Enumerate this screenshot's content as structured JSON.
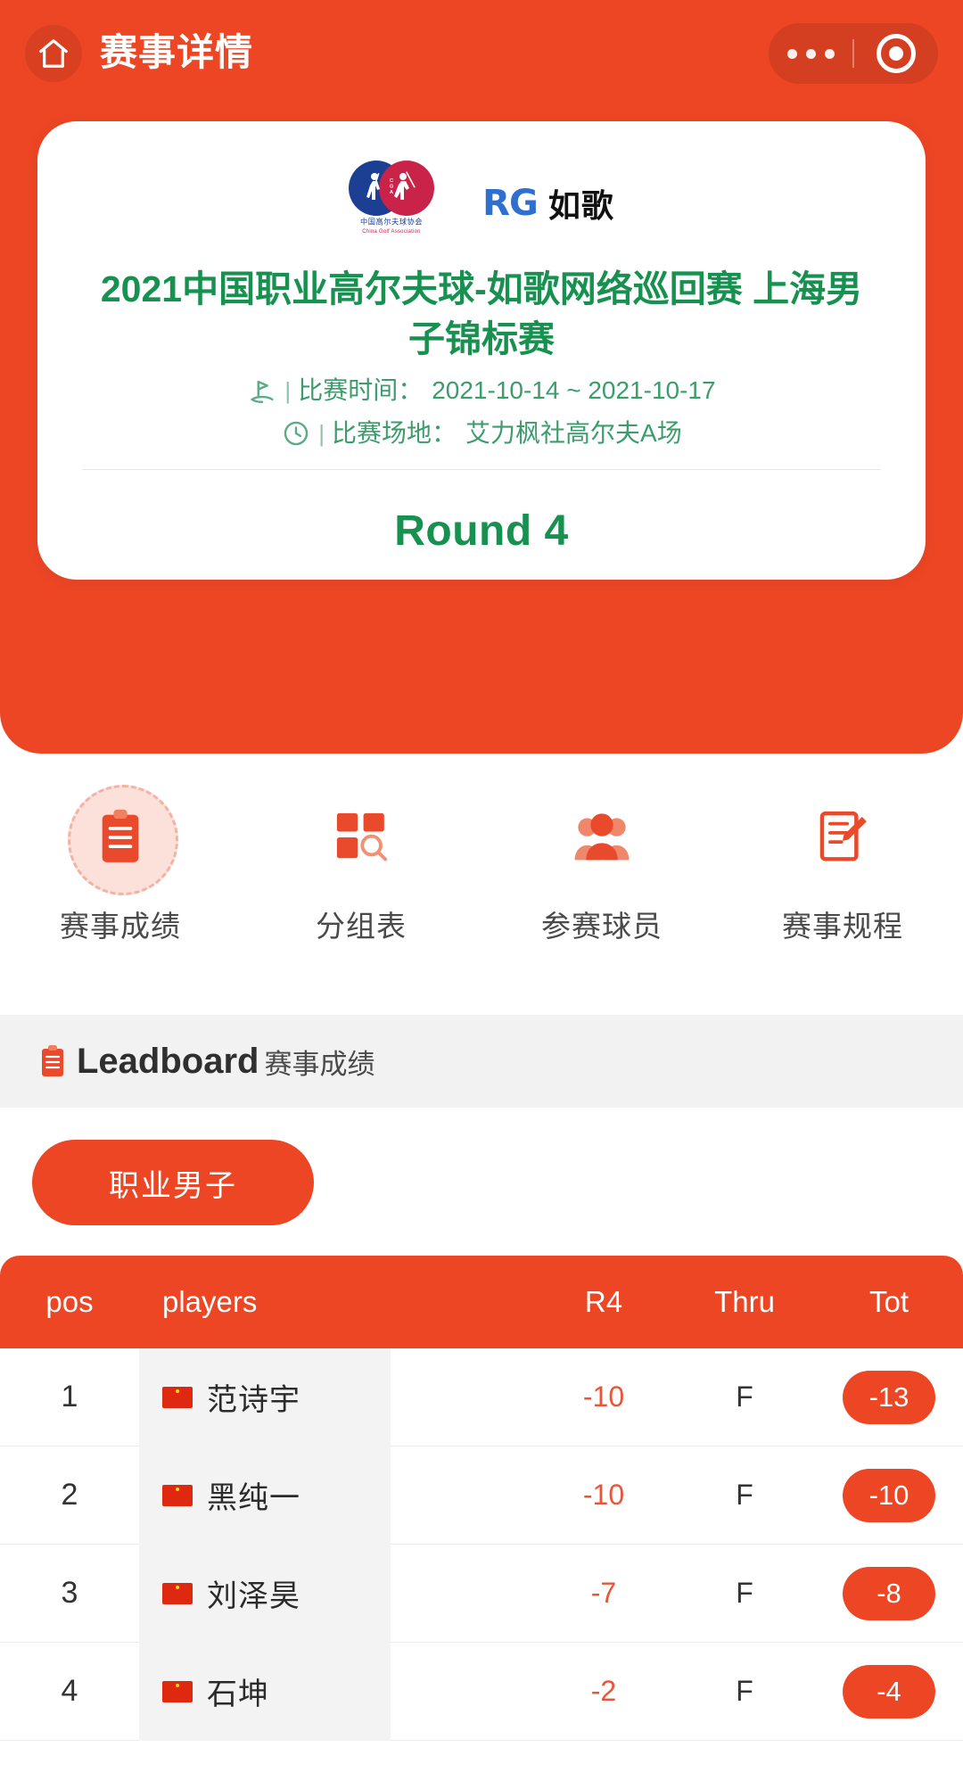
{
  "navbar": {
    "home_icon": "home-icon",
    "title": "赛事详情",
    "capsule": {
      "more_icon": "ellipsis-icon",
      "target_icon": "target-circle-icon"
    }
  },
  "card": {
    "logos": {
      "cga": {
        "cn": "中国高尔夫球协会",
        "en": "China Golf Association"
      },
      "rg": {
        "mark": "RG",
        "cn": "如歌"
      }
    },
    "title": "2021中国职业高尔夫球-如歌网络巡回赛 上海男子锦标赛",
    "meta": [
      {
        "icon": "golf-flag-icon",
        "label": "比赛时间：",
        "value": "2021-10-14 ~ 2021-10-17"
      },
      {
        "icon": "clock-icon",
        "label": "比赛场地：",
        "value": "艾力枫社高尔夫A场"
      }
    ],
    "round": "Round 4"
  },
  "menu": [
    {
      "icon": "clipboard-icon",
      "label": "赛事成绩",
      "active": true
    },
    {
      "icon": "grid-search-icon",
      "label": "分组表",
      "active": false
    },
    {
      "icon": "people-icon",
      "label": "参赛球员",
      "active": false
    },
    {
      "icon": "document-pencil-icon",
      "label": "赛事规程",
      "active": false
    }
  ],
  "section": {
    "icon": "clipboard-icon",
    "title_en": "Leadboard",
    "title_cn": "赛事成绩"
  },
  "category_tabs": [
    {
      "label": "职业男子",
      "active": true
    }
  ],
  "leaderboard": {
    "columns": [
      "pos",
      "players",
      "R4",
      "Thru",
      "Tot"
    ],
    "rows": [
      {
        "pos": "1",
        "flag": "cn-flag-icon",
        "player": "范诗宇",
        "r4": "-10",
        "thru": "F",
        "tot": "-13"
      },
      {
        "pos": "2",
        "flag": "cn-flag-icon",
        "player": "黑纯一",
        "r4": "-10",
        "thru": "F",
        "tot": "-10"
      },
      {
        "pos": "3",
        "flag": "cn-flag-icon",
        "player": "刘泽昊",
        "r4": "-7",
        "thru": "F",
        "tot": "-8"
      },
      {
        "pos": "4",
        "flag": "cn-flag-icon",
        "player": "石坤",
        "r4": "-2",
        "thru": "F",
        "tot": "-4"
      }
    ]
  },
  "colors": {
    "brand_orange": "#ec4625",
    "green": "#17914f",
    "meta_green": "#3c9c6c",
    "score_red": "#e8563a",
    "band_gray": "#f2f2f2",
    "player_cell_gray": "#f3f3f3"
  }
}
